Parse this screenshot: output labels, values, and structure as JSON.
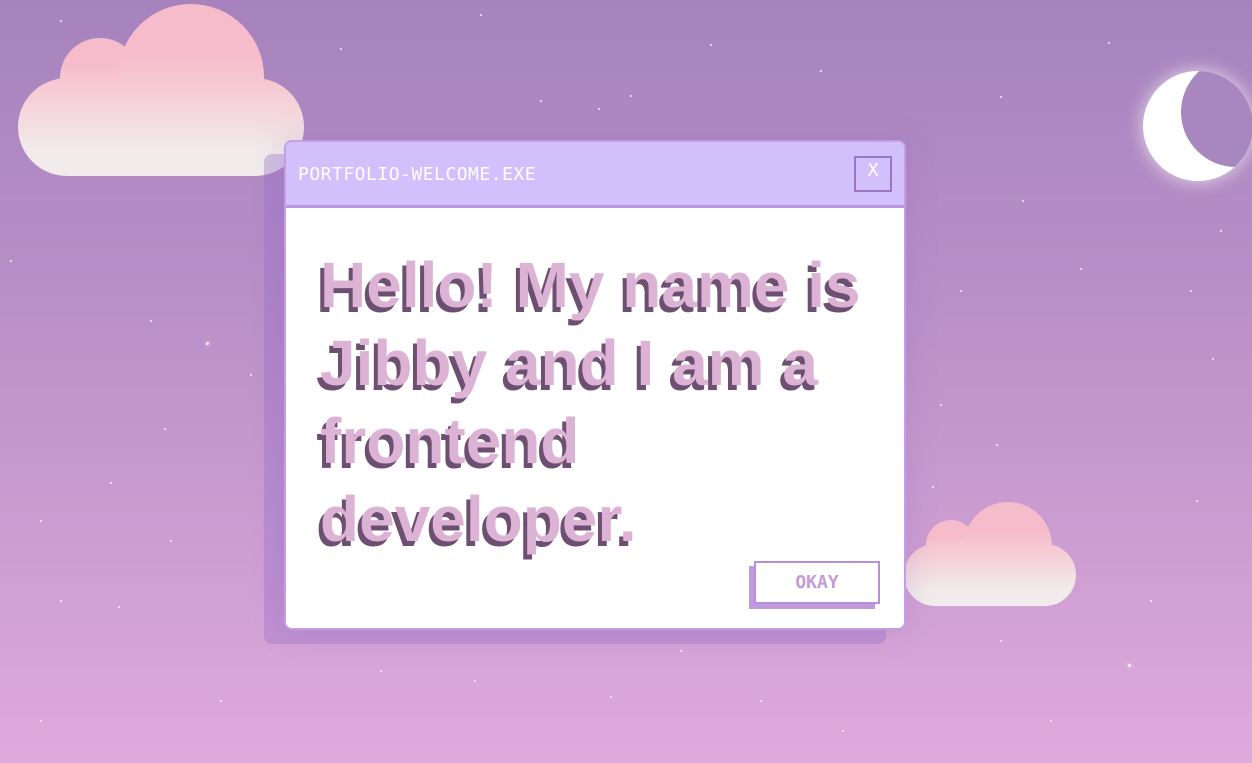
{
  "window": {
    "title": "PORTFOLIO-WELCOME.EXE",
    "close_label": "X"
  },
  "message": {
    "text": "Hello! My name is Jibby and I am a frontend developer."
  },
  "actions": {
    "ok_label": "OKAY"
  },
  "decor": {
    "moon_icon": "crescent-moon-icon",
    "cloud_icon": "cloud-icon"
  },
  "colors": {
    "sky_top": "#a683bd",
    "sky_bottom": "#dfaadc",
    "titlebar": "#d2c0fd",
    "text_fill": "#dcb3d5",
    "text_shadow": "#6d4f72",
    "cloud_pink": "#f7bccb"
  }
}
